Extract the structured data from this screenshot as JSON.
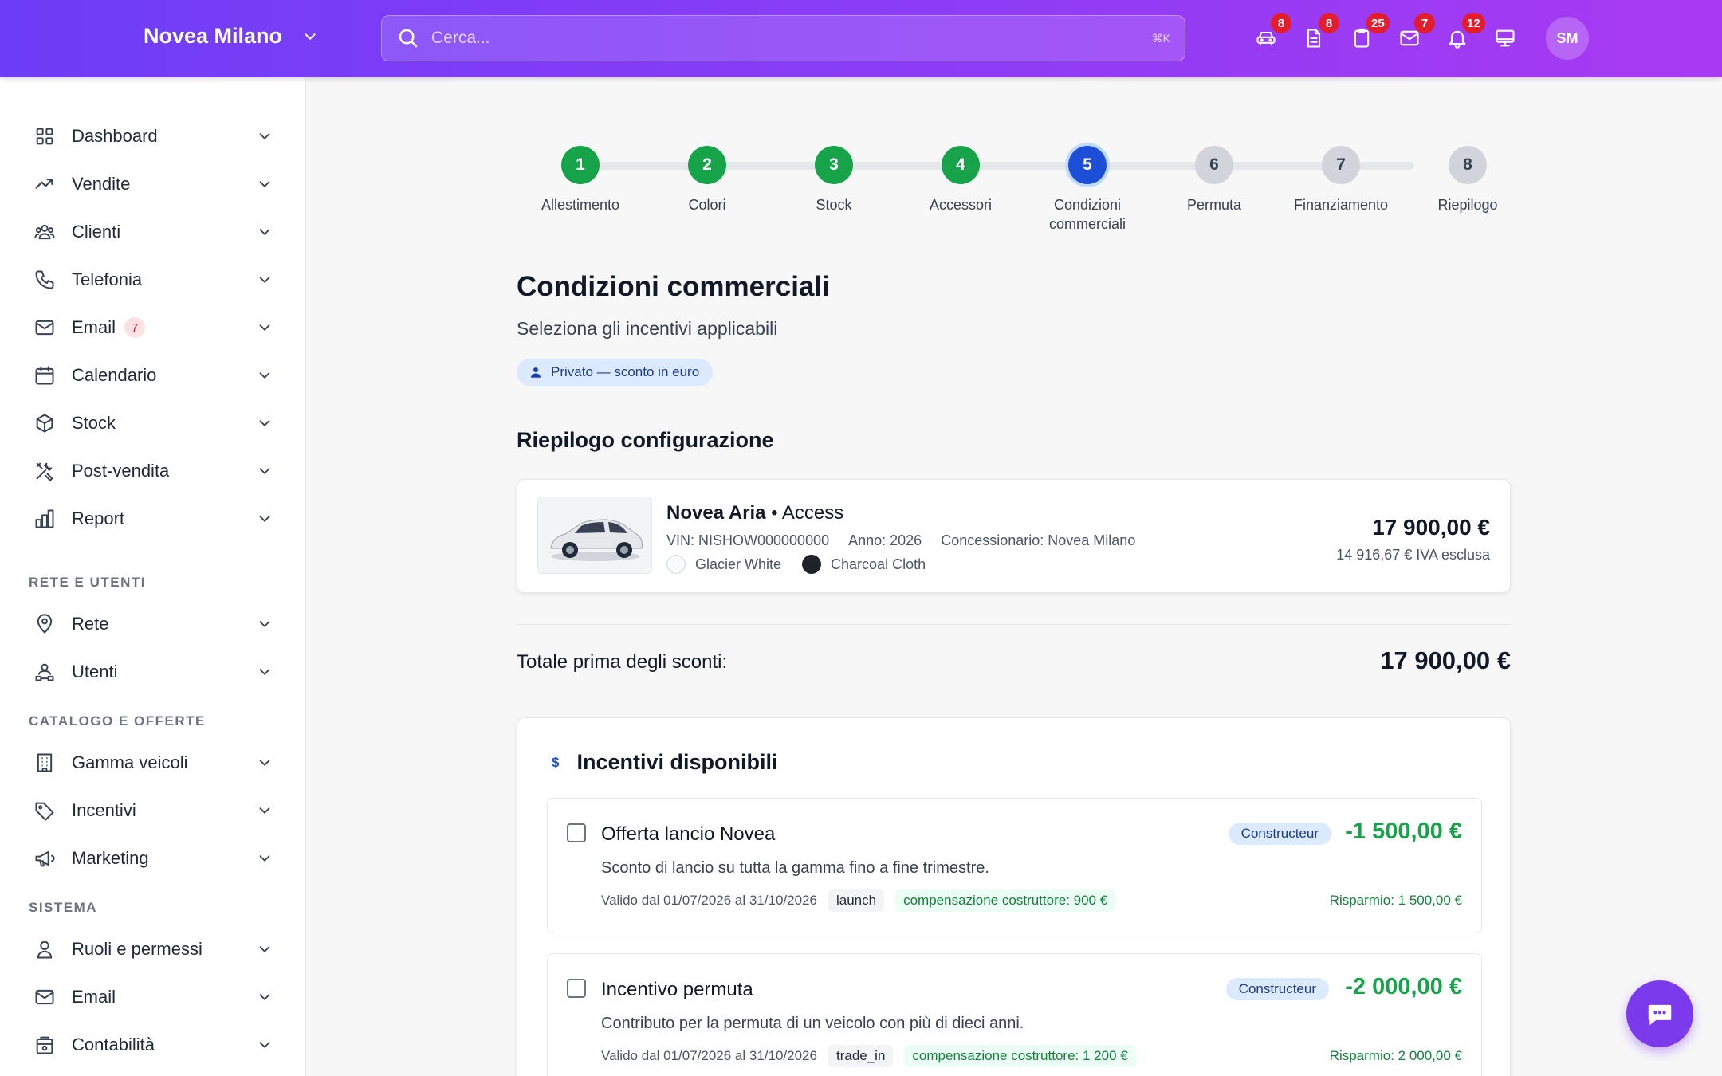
{
  "header": {
    "brand": "Novea Milano",
    "search_placeholder": "Cerca...",
    "search_shortcut": "⌘K",
    "icons": [
      {
        "name": "car-icon",
        "badge": "8"
      },
      {
        "name": "document-icon",
        "badge": "8"
      },
      {
        "name": "clipboard-icon",
        "badge": "25"
      },
      {
        "name": "mail-icon",
        "badge": "7"
      },
      {
        "name": "bell-icon",
        "badge": "12"
      },
      {
        "name": "monitor-icon",
        "badge": ""
      }
    ],
    "avatar": "SM"
  },
  "sidebar": {
    "items": [
      {
        "label": "Dashboard"
      },
      {
        "label": "Vendite"
      },
      {
        "label": "Clienti"
      },
      {
        "label": "Telefonia"
      },
      {
        "label": "Email",
        "badge": "7"
      },
      {
        "label": "Calendario"
      },
      {
        "label": "Stock"
      },
      {
        "label": "Post-vendita"
      },
      {
        "label": "Report"
      }
    ],
    "section_rete": "RETE E UTENTI",
    "rete_items": [
      {
        "label": "Rete"
      },
      {
        "label": "Utenti"
      }
    ],
    "section_catalogo": "CATALOGO E OFFERTE",
    "catalogo_items": [
      {
        "label": "Gamma veicoli"
      },
      {
        "label": "Incentivi"
      },
      {
        "label": "Marketing"
      }
    ],
    "section_sistema": "SISTEMA",
    "sistema_items": [
      {
        "label": "Ruoli e permessi"
      },
      {
        "label": "Email"
      },
      {
        "label": "Contabilità"
      }
    ]
  },
  "stepper": {
    "steps": [
      {
        "num": "1",
        "label": "Allestimento",
        "state": "done"
      },
      {
        "num": "2",
        "label": "Colori",
        "state": "done"
      },
      {
        "num": "3",
        "label": "Stock",
        "state": "done"
      },
      {
        "num": "4",
        "label": "Accessori",
        "state": "done"
      },
      {
        "num": "5",
        "label": "Condizioni commerciali",
        "state": "active"
      },
      {
        "num": "6",
        "label": "Permuta",
        "state": "todo"
      },
      {
        "num": "7",
        "label": "Finanziamento",
        "state": "todo"
      },
      {
        "num": "8",
        "label": "Riepilogo",
        "state": "todo"
      }
    ]
  },
  "page": {
    "title": "Condizioni commerciali",
    "subtitle": "Seleziona gli incentivi applicabili",
    "chip": "Privato — sconto in euro",
    "summary_title": "Riepilogo configurazione"
  },
  "config": {
    "model": "Novea Aria",
    "trim": "Access",
    "vin": "VIN: NISHOW000000000",
    "year": "Anno: 2026",
    "dealer": "Concessionario: Novea Milano",
    "color_ext": "Glacier White",
    "color_int": "Charcoal Cloth",
    "price": "17 900,00 €",
    "price_net": "14 916,67 € IVA esclusa"
  },
  "totals": {
    "label": "Totale prima degli sconti:",
    "value": "17 900,00 €"
  },
  "incentives": {
    "title": "Incentivi disponibili",
    "offers": [
      {
        "name": "Offerta lancio Novea",
        "tag": "Constructeur",
        "amount": "-1 500,00 €",
        "description": "Sconto di lancio su tutta la gamma fino a fine trimestre.",
        "validity": "Valido dal 01/07/2026 al 31/10/2026",
        "code": "launch",
        "compensation": "compensazione costruttore: 900 €",
        "saving": "Risparmio: 1 500,00 €"
      },
      {
        "name": "Incentivo permuta",
        "tag": "Constructeur",
        "amount": "-2 000,00 €",
        "description": "Contributo per la permuta di un veicolo con più di dieci anni.",
        "validity": "Valido dal 01/07/2026 al 31/10/2026",
        "code": "trade_in",
        "compensation": "compensazione costruttore: 1 200 €",
        "saving": "Risparmio: 2 000,00 €"
      }
    ]
  },
  "colors": {
    "brand_start": "#6e3df7",
    "brand_end": "#a83af2",
    "success": "#16a34a",
    "active_step": "#1d4ed8",
    "badge": "#e11d2e"
  }
}
